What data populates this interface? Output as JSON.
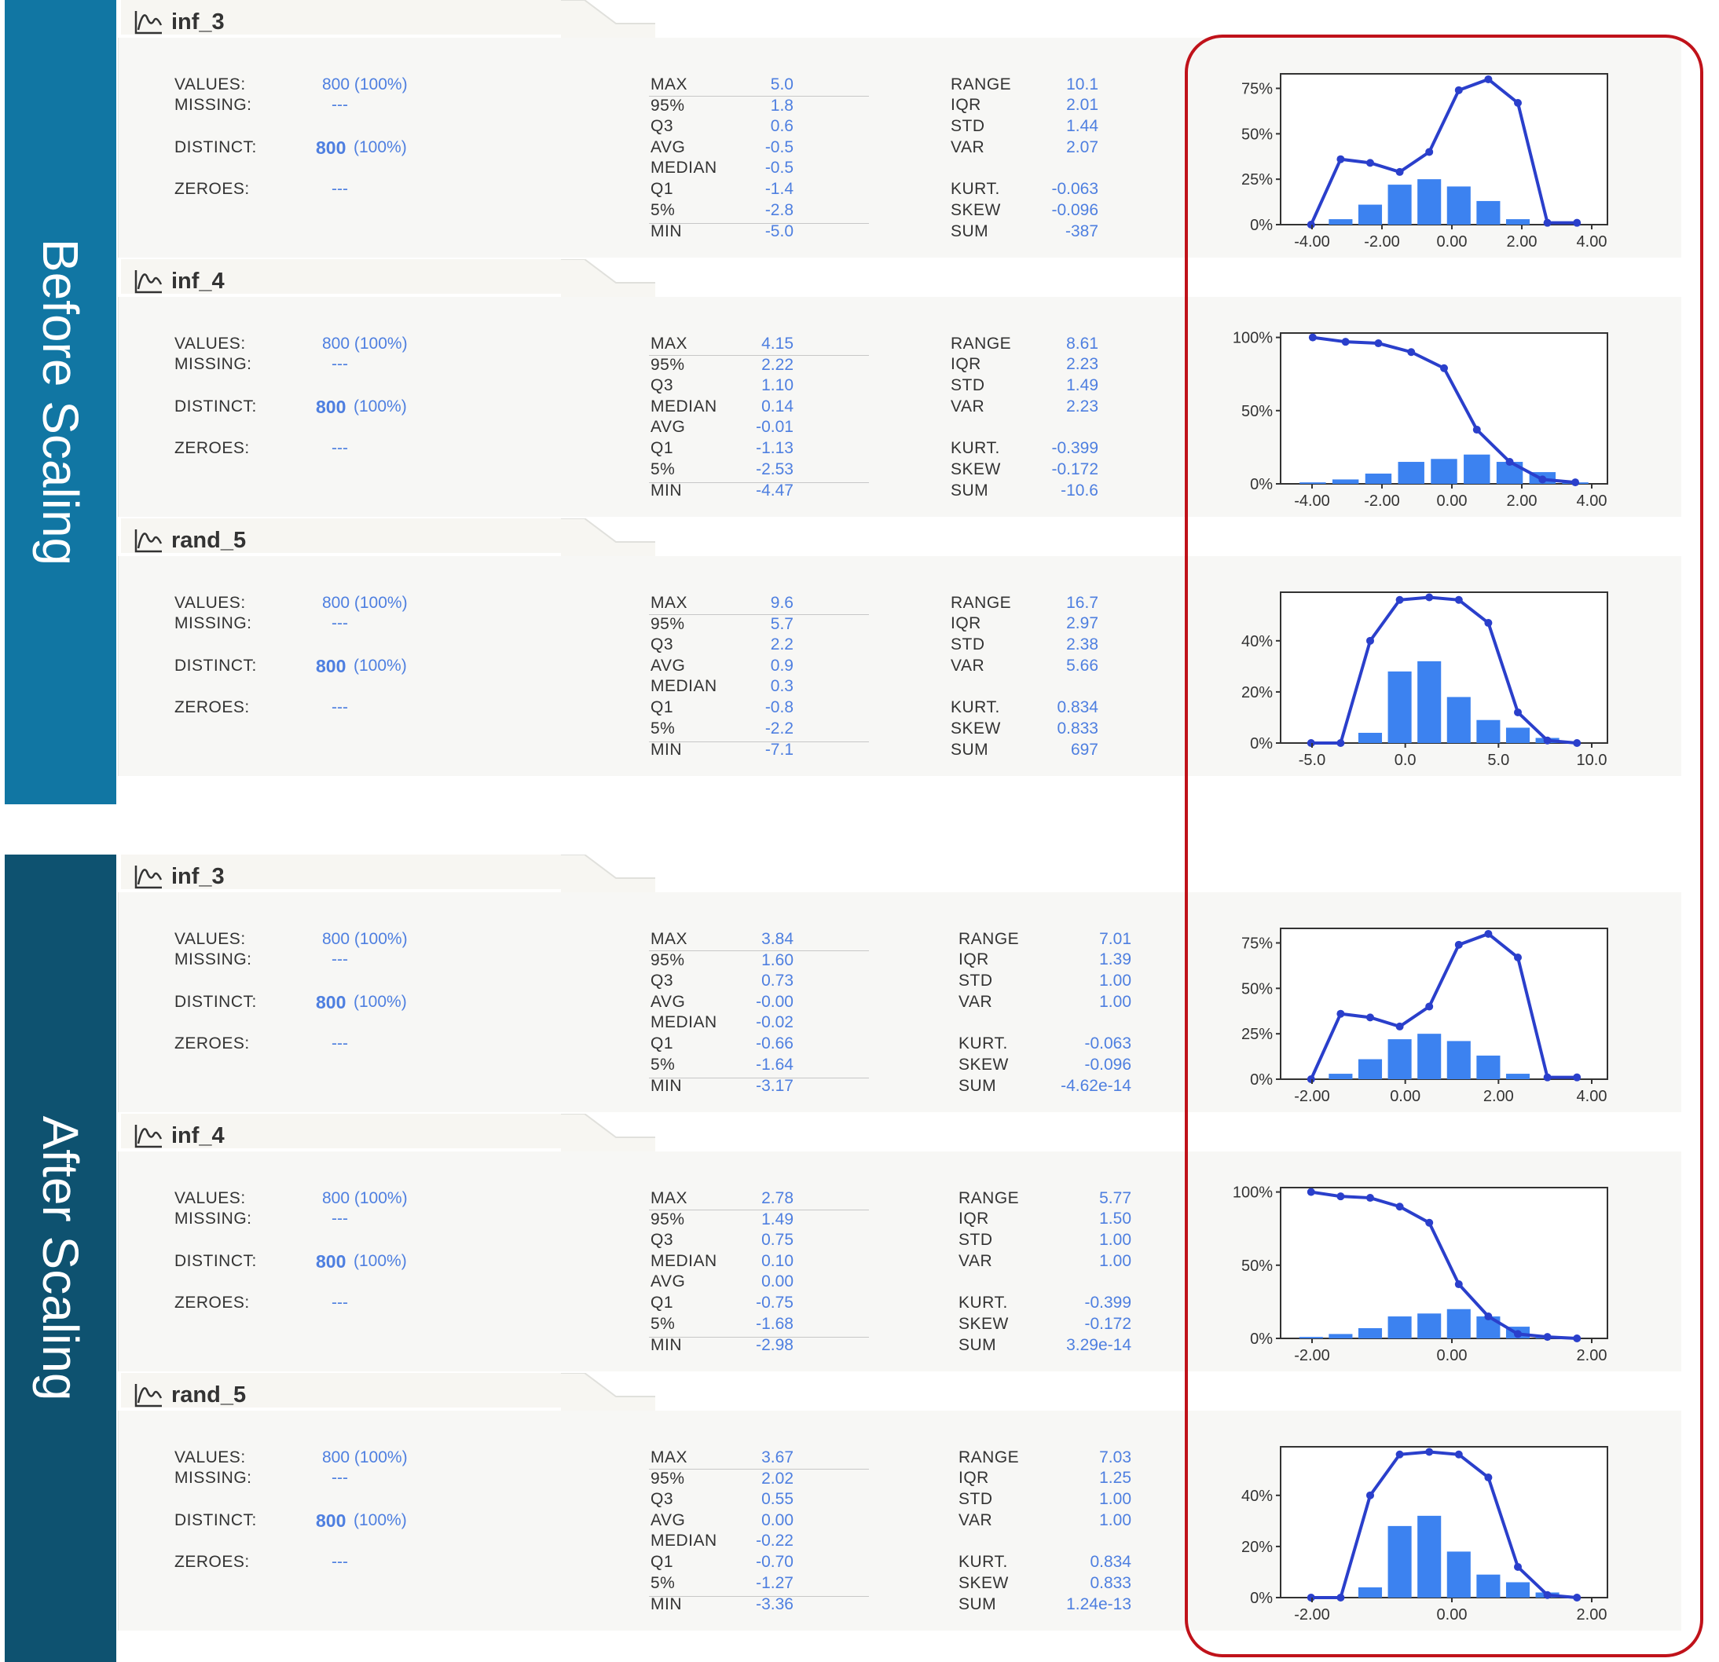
{
  "sections": [
    {
      "label": "Before Scaling",
      "cards": [
        {
          "name": "inf_3",
          "values_label": "VALUES:",
          "values_val": "800 (100%)",
          "missing_label": "MISSING:",
          "missing_val": "---",
          "distinct_label": "DISTINCT:",
          "distinct_num": "800",
          "distinct_pct": "(100%)",
          "zeroes_label": "ZEROES:",
          "zeroes_val": "---",
          "quant": [
            [
              "MAX",
              "5.0"
            ],
            [
              "95%",
              "1.8"
            ],
            [
              "Q3",
              "0.6"
            ],
            [
              "AVG",
              "-0.5"
            ],
            [
              "MEDIAN",
              "-0.5"
            ],
            [
              "Q1",
              "-1.4"
            ],
            [
              "5%",
              "-2.8"
            ],
            [
              "MIN",
              "-5.0"
            ]
          ],
          "stats": [
            [
              "RANGE",
              "10.1"
            ],
            [
              "IQR",
              "2.01"
            ],
            [
              "STD",
              "1.44"
            ],
            [
              "VAR",
              "2.07"
            ],
            [
              "KURT.",
              "-0.063"
            ],
            [
              "SKEW",
              "-0.096"
            ],
            [
              "SUM",
              "-387"
            ]
          ]
        },
        {
          "name": "inf_4",
          "values_label": "VALUES:",
          "values_val": "800 (100%)",
          "missing_label": "MISSING:",
          "missing_val": "---",
          "distinct_label": "DISTINCT:",
          "distinct_num": "800",
          "distinct_pct": "(100%)",
          "zeroes_label": "ZEROES:",
          "zeroes_val": "---",
          "quant": [
            [
              "MAX",
              "4.15"
            ],
            [
              "95%",
              "2.22"
            ],
            [
              "Q3",
              "1.10"
            ],
            [
              "MEDIAN",
              "0.14"
            ],
            [
              "AVG",
              "-0.01"
            ],
            [
              "Q1",
              "-1.13"
            ],
            [
              "5%",
              "-2.53"
            ],
            [
              "MIN",
              "-4.47"
            ]
          ],
          "stats": [
            [
              "RANGE",
              "8.61"
            ],
            [
              "IQR",
              "2.23"
            ],
            [
              "STD",
              "1.49"
            ],
            [
              "VAR",
              "2.23"
            ],
            [
              "KURT.",
              "-0.399"
            ],
            [
              "SKEW",
              "-0.172"
            ],
            [
              "SUM",
              "-10.6"
            ]
          ]
        },
        {
          "name": "rand_5",
          "values_label": "VALUES:",
          "values_val": "800 (100%)",
          "missing_label": "MISSING:",
          "missing_val": "---",
          "distinct_label": "DISTINCT:",
          "distinct_num": "800",
          "distinct_pct": "(100%)",
          "zeroes_label": "ZEROES:",
          "zeroes_val": "---",
          "quant": [
            [
              "MAX",
              "9.6"
            ],
            [
              "95%",
              "5.7"
            ],
            [
              "Q3",
              "2.2"
            ],
            [
              "AVG",
              "0.9"
            ],
            [
              "MEDIAN",
              "0.3"
            ],
            [
              "Q1",
              "-0.8"
            ],
            [
              "5%",
              "-2.2"
            ],
            [
              "MIN",
              "-7.1"
            ]
          ],
          "stats": [
            [
              "RANGE",
              "16.7"
            ],
            [
              "IQR",
              "2.97"
            ],
            [
              "STD",
              "2.38"
            ],
            [
              "VAR",
              "5.66"
            ],
            [
              "KURT.",
              "0.834"
            ],
            [
              "SKEW",
              "0.833"
            ],
            [
              "SUM",
              "697"
            ]
          ]
        }
      ]
    },
    {
      "label": "After Scaling",
      "cards": [
        {
          "name": "inf_3",
          "values_label": "VALUES:",
          "values_val": "800 (100%)",
          "missing_label": "MISSING:",
          "missing_val": "---",
          "distinct_label": "DISTINCT:",
          "distinct_num": "800",
          "distinct_pct": "(100%)",
          "zeroes_label": "ZEROES:",
          "zeroes_val": "---",
          "quant": [
            [
              "MAX",
              "3.84"
            ],
            [
              "95%",
              "1.60"
            ],
            [
              "Q3",
              "0.73"
            ],
            [
              "AVG",
              "-0.00"
            ],
            [
              "MEDIAN",
              "-0.02"
            ],
            [
              "Q1",
              "-0.66"
            ],
            [
              "5%",
              "-1.64"
            ],
            [
              "MIN",
              "-3.17"
            ]
          ],
          "stats": [
            [
              "RANGE",
              "7.01"
            ],
            [
              "IQR",
              "1.39"
            ],
            [
              "STD",
              "1.00"
            ],
            [
              "VAR",
              "1.00"
            ],
            [
              "KURT.",
              "-0.063"
            ],
            [
              "SKEW",
              "-0.096"
            ],
            [
              "SUM",
              "-4.62e-14"
            ]
          ]
        },
        {
          "name": "inf_4",
          "values_label": "VALUES:",
          "values_val": "800 (100%)",
          "missing_label": "MISSING:",
          "missing_val": "---",
          "distinct_label": "DISTINCT:",
          "distinct_num": "800",
          "distinct_pct": "(100%)",
          "zeroes_label": "ZEROES:",
          "zeroes_val": "---",
          "quant": [
            [
              "MAX",
              "2.78"
            ],
            [
              "95%",
              "1.49"
            ],
            [
              "Q3",
              "0.75"
            ],
            [
              "MEDIAN",
              "0.10"
            ],
            [
              "AVG",
              "0.00"
            ],
            [
              "Q1",
              "-0.75"
            ],
            [
              "5%",
              "-1.68"
            ],
            [
              "MIN",
              "-2.98"
            ]
          ],
          "stats": [
            [
              "RANGE",
              "5.77"
            ],
            [
              "IQR",
              "1.50"
            ],
            [
              "STD",
              "1.00"
            ],
            [
              "VAR",
              "1.00"
            ],
            [
              "KURT.",
              "-0.399"
            ],
            [
              "SKEW",
              "-0.172"
            ],
            [
              "SUM",
              "3.29e-14"
            ]
          ]
        },
        {
          "name": "rand_5",
          "values_label": "VALUES:",
          "values_val": "800 (100%)",
          "missing_label": "MISSING:",
          "missing_val": "---",
          "distinct_label": "DISTINCT:",
          "distinct_num": "800",
          "distinct_pct": "(100%)",
          "zeroes_label": "ZEROES:",
          "zeroes_val": "---",
          "quant": [
            [
              "MAX",
              "3.67"
            ],
            [
              "95%",
              "2.02"
            ],
            [
              "Q3",
              "0.55"
            ],
            [
              "AVG",
              "0.00"
            ],
            [
              "MEDIAN",
              "-0.22"
            ],
            [
              "Q1",
              "-0.70"
            ],
            [
              "5%",
              "-1.27"
            ],
            [
              "MIN",
              "-3.36"
            ]
          ],
          "stats": [
            [
              "RANGE",
              "7.03"
            ],
            [
              "IQR",
              "1.25"
            ],
            [
              "STD",
              "1.00"
            ],
            [
              "VAR",
              "1.00"
            ],
            [
              "KURT.",
              "0.834"
            ],
            [
              "SKEW",
              "0.833"
            ],
            [
              "SUM",
              "1.24e-13"
            ]
          ]
        }
      ]
    }
  ],
  "colors": {
    "accent": "#4e7fe0",
    "bar": "#3c82f0",
    "line": "#2a3fcb",
    "highlight": "#c0121a",
    "before_band": "#1176a3",
    "after_band": "#0e5270"
  },
  "chart_data": [
    {
      "type": "bar",
      "section": "Before Scaling",
      "column": "inf_3",
      "x": [
        -4.5,
        -3.5,
        -2.5,
        -1.5,
        -0.5,
        0.5,
        1.5,
        2.5,
        3.5,
        4.5
      ],
      "values": [
        0,
        3,
        11,
        22,
        25,
        21,
        13,
        3,
        0,
        0
      ],
      "cumulative_line": [
        0,
        36,
        34,
        29,
        40,
        74,
        80,
        67,
        1,
        1
      ],
      "xticks": [
        "-4.00",
        "-2.00",
        "0.00",
        "2.00",
        "4.00"
      ],
      "xlim": [
        -5.0,
        5.0
      ],
      "yticks": [
        "0%",
        "25%",
        "50%",
        "75%"
      ],
      "ylim": [
        0,
        83
      ]
    },
    {
      "type": "bar",
      "section": "Before Scaling",
      "column": "inf_4",
      "x": [
        -4.0,
        -3.0,
        -2.0,
        -1.0,
        0.0,
        1.0,
        2.0,
        3.0,
        4.0
      ],
      "values": [
        1,
        3,
        7,
        15,
        17,
        20,
        15,
        8,
        1
      ],
      "cumulative_line": [
        100,
        97,
        96,
        90,
        79,
        37,
        15,
        3,
        1
      ],
      "xticks": [
        "-4.00",
        "-2.00",
        "0.00",
        "2.00",
        "4.00"
      ],
      "xlim": [
        -4.47,
        4.15
      ],
      "yticks": [
        "0%",
        "50%",
        "100%"
      ],
      "ylim": [
        0,
        103
      ]
    },
    {
      "type": "bar",
      "section": "Before Scaling",
      "column": "rand_5",
      "x": [
        -6.0,
        -4.0,
        -2.0,
        0.0,
        2.0,
        4.0,
        6.0,
        8.0
      ],
      "values": [
        0,
        0,
        4,
        28,
        32,
        18,
        9,
        6,
        2,
        0
      ],
      "bins_x": [
        -6.0,
        -4.3,
        -2.5,
        -0.8,
        0.9,
        2.6,
        4.3,
        6.0,
        7.7,
        9.4
      ],
      "cumulative_line": [
        0,
        0,
        40,
        56,
        57,
        56,
        47,
        12,
        1,
        0
      ],
      "xticks": [
        "-5.0",
        "0.0",
        "5.0",
        "10.0"
      ],
      "xlim": [
        -7.1,
        10.0
      ],
      "yticks": [
        "0%",
        "20%",
        "40%"
      ],
      "ylim": [
        0,
        59
      ]
    },
    {
      "type": "bar",
      "section": "After Scaling",
      "column": "inf_3",
      "x": [
        -3.0,
        -2.5,
        -2.0,
        -1.5,
        -1.0,
        -0.5,
        0.0,
        0.5,
        1.0,
        1.5,
        2.0,
        2.5,
        3.0,
        3.5
      ],
      "values": [
        0,
        3,
        11,
        22,
        25,
        21,
        13,
        3,
        0,
        0
      ],
      "bins_x": [
        -2.7,
        -2.0,
        -1.3,
        -0.65,
        0.0,
        0.65,
        1.3,
        2.0,
        2.7,
        3.4
      ],
      "cumulative_line": [
        0,
        36,
        34,
        29,
        40,
        74,
        80,
        67,
        1,
        1
      ],
      "xticks": [
        "-2.00",
        "0.00",
        "2.00",
        "4.00"
      ],
      "xlim": [
        -3.17,
        4.0
      ],
      "yticks": [
        "0%",
        "25%",
        "50%",
        "75%"
      ],
      "ylim": [
        0,
        83
      ]
    },
    {
      "type": "bar",
      "section": "After Scaling",
      "column": "inf_4",
      "bins_x": [
        -2.7,
        -2.15,
        -1.6,
        -1.05,
        -0.5,
        0.05,
        0.6,
        1.15,
        1.7,
        2.25
      ],
      "values": [
        1,
        3,
        7,
        15,
        17,
        20,
        15,
        8,
        1,
        0
      ],
      "cumulative_line": [
        100,
        97,
        96,
        90,
        79,
        37,
        15,
        3,
        1,
        0
      ],
      "xticks": [
        "-2.00",
        "0.00",
        "2.00"
      ],
      "xlim": [
        -2.98,
        2.78
      ],
      "yticks": [
        "0%",
        "50%",
        "100%"
      ],
      "ylim": [
        0,
        103
      ]
    },
    {
      "type": "bar",
      "section": "After Scaling",
      "column": "rand_5",
      "bins_x": [
        -2.9,
        -2.2,
        -1.5,
        -0.8,
        -0.1,
        0.6,
        1.3,
        2.0,
        2.7,
        3.4
      ],
      "values": [
        0,
        0,
        4,
        28,
        32,
        18,
        9,
        6,
        2,
        0
      ],
      "cumulative_line": [
        0,
        0,
        40,
        56,
        57,
        56,
        47,
        12,
        1,
        0
      ],
      "xticks": [
        "-2.00",
        "0.00",
        "2.00"
      ],
      "xlim": [
        -3.36,
        3.67
      ],
      "yticks": [
        "0%",
        "20%",
        "40%"
      ],
      "ylim": [
        0,
        59
      ]
    }
  ]
}
